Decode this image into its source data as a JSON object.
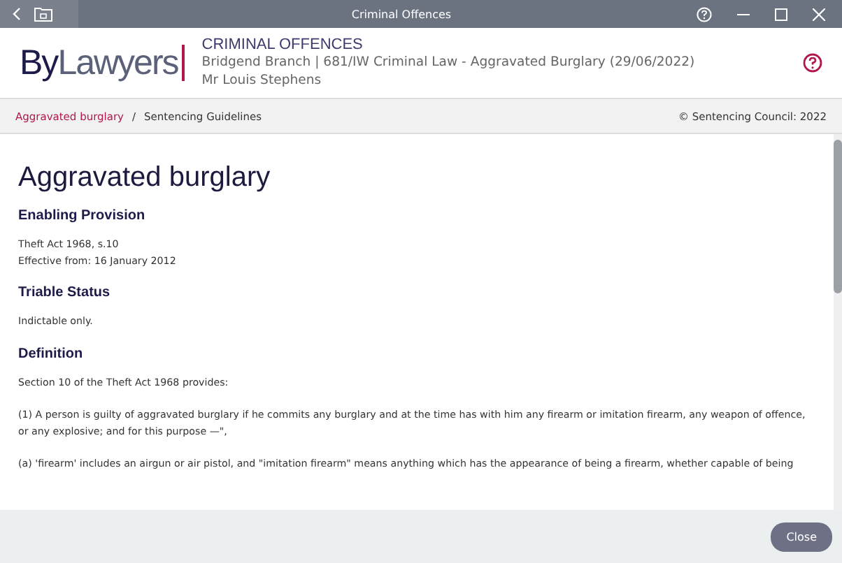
{
  "window": {
    "title": "Criminal Offences"
  },
  "header": {
    "logo_left": "By",
    "logo_right": "Lawyers",
    "title": "CRIMINAL OFFENCES",
    "matter": "Bridgend Branch | 681/IW Criminal Law - Aggravated Burglary (29/06/2022)",
    "client": "Mr Louis Stephens"
  },
  "breadcrumb": {
    "link": "Aggravated burglary",
    "separator": "/",
    "current": "Sentencing Guidelines",
    "copyright": "© Sentencing Council: 2022"
  },
  "content": {
    "title": "Aggravated burglary",
    "sections": [
      {
        "heading": "Enabling Provision",
        "paragraphs": [
          [
            "Theft Act 1968, s.10",
            "Effective from: 16 January 2012"
          ]
        ]
      },
      {
        "heading": "Triable Status",
        "paragraphs": [
          [
            "Indictable only."
          ]
        ]
      },
      {
        "heading": "Definition",
        "paragraphs": [
          [
            "Section 10 of the Theft Act 1968 provides:"
          ],
          [
            "(1) A person is guilty of aggravated burglary if he commits any burglary and at the time has with him any firearm or imitation firearm, any weapon of offence, or any explosive; and for this purpose —\","
          ],
          [
            "(a) 'firearm' includes an airgun or air pistol, and \"imitation firearm\" means anything which has the appearance of being a firearm, whether capable of being"
          ]
        ]
      }
    ]
  },
  "footer": {
    "button": "Close"
  }
}
